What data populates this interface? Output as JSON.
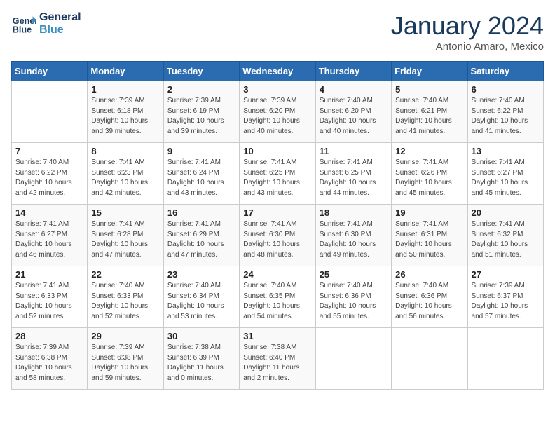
{
  "header": {
    "logo_line1": "General",
    "logo_line2": "Blue",
    "month": "January 2024",
    "location": "Antonio Amaro, Mexico"
  },
  "days_of_week": [
    "Sunday",
    "Monday",
    "Tuesday",
    "Wednesday",
    "Thursday",
    "Friday",
    "Saturday"
  ],
  "weeks": [
    [
      {
        "num": "",
        "info": ""
      },
      {
        "num": "1",
        "info": "Sunrise: 7:39 AM\nSunset: 6:18 PM\nDaylight: 10 hours\nand 39 minutes."
      },
      {
        "num": "2",
        "info": "Sunrise: 7:39 AM\nSunset: 6:19 PM\nDaylight: 10 hours\nand 39 minutes."
      },
      {
        "num": "3",
        "info": "Sunrise: 7:39 AM\nSunset: 6:20 PM\nDaylight: 10 hours\nand 40 minutes."
      },
      {
        "num": "4",
        "info": "Sunrise: 7:40 AM\nSunset: 6:20 PM\nDaylight: 10 hours\nand 40 minutes."
      },
      {
        "num": "5",
        "info": "Sunrise: 7:40 AM\nSunset: 6:21 PM\nDaylight: 10 hours\nand 41 minutes."
      },
      {
        "num": "6",
        "info": "Sunrise: 7:40 AM\nSunset: 6:22 PM\nDaylight: 10 hours\nand 41 minutes."
      }
    ],
    [
      {
        "num": "7",
        "info": "Sunrise: 7:40 AM\nSunset: 6:22 PM\nDaylight: 10 hours\nand 42 minutes."
      },
      {
        "num": "8",
        "info": "Sunrise: 7:41 AM\nSunset: 6:23 PM\nDaylight: 10 hours\nand 42 minutes."
      },
      {
        "num": "9",
        "info": "Sunrise: 7:41 AM\nSunset: 6:24 PM\nDaylight: 10 hours\nand 43 minutes."
      },
      {
        "num": "10",
        "info": "Sunrise: 7:41 AM\nSunset: 6:25 PM\nDaylight: 10 hours\nand 43 minutes."
      },
      {
        "num": "11",
        "info": "Sunrise: 7:41 AM\nSunset: 6:25 PM\nDaylight: 10 hours\nand 44 minutes."
      },
      {
        "num": "12",
        "info": "Sunrise: 7:41 AM\nSunset: 6:26 PM\nDaylight: 10 hours\nand 45 minutes."
      },
      {
        "num": "13",
        "info": "Sunrise: 7:41 AM\nSunset: 6:27 PM\nDaylight: 10 hours\nand 45 minutes."
      }
    ],
    [
      {
        "num": "14",
        "info": "Sunrise: 7:41 AM\nSunset: 6:27 PM\nDaylight: 10 hours\nand 46 minutes."
      },
      {
        "num": "15",
        "info": "Sunrise: 7:41 AM\nSunset: 6:28 PM\nDaylight: 10 hours\nand 47 minutes."
      },
      {
        "num": "16",
        "info": "Sunrise: 7:41 AM\nSunset: 6:29 PM\nDaylight: 10 hours\nand 47 minutes."
      },
      {
        "num": "17",
        "info": "Sunrise: 7:41 AM\nSunset: 6:30 PM\nDaylight: 10 hours\nand 48 minutes."
      },
      {
        "num": "18",
        "info": "Sunrise: 7:41 AM\nSunset: 6:30 PM\nDaylight: 10 hours\nand 49 minutes."
      },
      {
        "num": "19",
        "info": "Sunrise: 7:41 AM\nSunset: 6:31 PM\nDaylight: 10 hours\nand 50 minutes."
      },
      {
        "num": "20",
        "info": "Sunrise: 7:41 AM\nSunset: 6:32 PM\nDaylight: 10 hours\nand 51 minutes."
      }
    ],
    [
      {
        "num": "21",
        "info": "Sunrise: 7:41 AM\nSunset: 6:33 PM\nDaylight: 10 hours\nand 52 minutes."
      },
      {
        "num": "22",
        "info": "Sunrise: 7:40 AM\nSunset: 6:33 PM\nDaylight: 10 hours\nand 52 minutes."
      },
      {
        "num": "23",
        "info": "Sunrise: 7:40 AM\nSunset: 6:34 PM\nDaylight: 10 hours\nand 53 minutes."
      },
      {
        "num": "24",
        "info": "Sunrise: 7:40 AM\nSunset: 6:35 PM\nDaylight: 10 hours\nand 54 minutes."
      },
      {
        "num": "25",
        "info": "Sunrise: 7:40 AM\nSunset: 6:36 PM\nDaylight: 10 hours\nand 55 minutes."
      },
      {
        "num": "26",
        "info": "Sunrise: 7:40 AM\nSunset: 6:36 PM\nDaylight: 10 hours\nand 56 minutes."
      },
      {
        "num": "27",
        "info": "Sunrise: 7:39 AM\nSunset: 6:37 PM\nDaylight: 10 hours\nand 57 minutes."
      }
    ],
    [
      {
        "num": "28",
        "info": "Sunrise: 7:39 AM\nSunset: 6:38 PM\nDaylight: 10 hours\nand 58 minutes."
      },
      {
        "num": "29",
        "info": "Sunrise: 7:39 AM\nSunset: 6:38 PM\nDaylight: 10 hours\nand 59 minutes."
      },
      {
        "num": "30",
        "info": "Sunrise: 7:38 AM\nSunset: 6:39 PM\nDaylight: 11 hours\nand 0 minutes."
      },
      {
        "num": "31",
        "info": "Sunrise: 7:38 AM\nSunset: 6:40 PM\nDaylight: 11 hours\nand 2 minutes."
      },
      {
        "num": "",
        "info": ""
      },
      {
        "num": "",
        "info": ""
      },
      {
        "num": "",
        "info": ""
      }
    ]
  ]
}
